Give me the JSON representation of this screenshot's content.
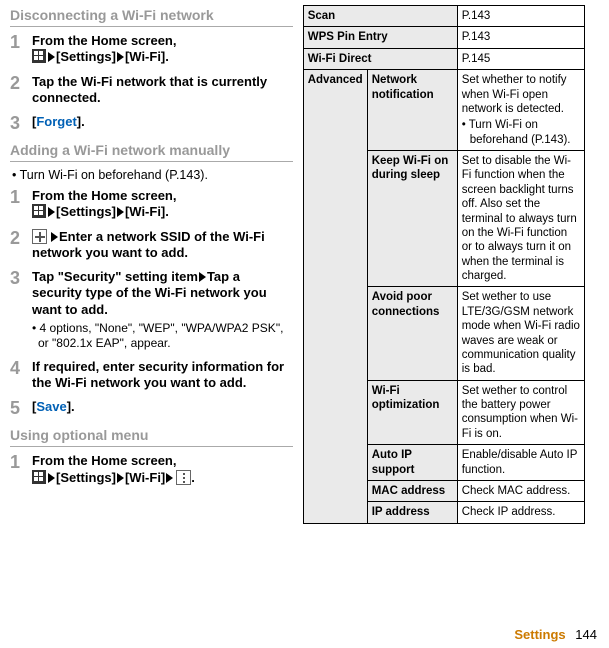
{
  "sections": {
    "disconnect_heading": "Disconnecting a Wi-Fi network",
    "add_heading": "Adding a Wi-Fi network manually",
    "optional_heading": "Using optional menu"
  },
  "disc_steps": {
    "s1a": "From the Home screen,",
    "s1b": "[Settings]",
    "s1c": "[Wi-Fi].",
    "s2": "Tap the Wi-Fi network that is currently connected.",
    "s3_open": "[",
    "s3_link": "Forget",
    "s3_close": "]."
  },
  "add_note": "Turn Wi-Fi on beforehand (P.143).",
  "add_steps": {
    "s1a": "From the Home screen,",
    "s1b": "[Settings]",
    "s1c": "[Wi-Fi].",
    "s2": "Enter a network SSID of the Wi-Fi network you want to add.",
    "s3a": "Tap \"Security\" setting item",
    "s3b": "Tap a security type of the Wi-Fi network you want to add.",
    "s3_sub": "4 options, \"None\", \"WEP\", \"WPA/WPA2 PSK\", or \"802.1x EAP\", appear.",
    "s4": "If required, enter security information for the Wi-Fi network you want to add.",
    "s5_open": "[",
    "s5_link": "Save",
    "s5_close": "]."
  },
  "opt_steps": {
    "s1a": "From the Home screen,",
    "s1b": "[Settings]",
    "s1c": "[Wi-Fi]",
    "s1d": "."
  },
  "table": {
    "scan_k": "Scan",
    "scan_v": "P.143",
    "wps_k": "WPS Pin Entry",
    "wps_v": "P.143",
    "wfd_k": "Wi-Fi Direct",
    "wfd_v": "P.145",
    "adv": "Advanced",
    "nn_k": "Network notification",
    "nn_v": "Set whether to notify when Wi-Fi open network is detected.",
    "nn_sub": "Turn Wi-Fi on beforehand (P.143).",
    "sleep_k": "Keep Wi-Fi on during sleep",
    "sleep_v": "Set to disable the Wi-Fi function when the screen backlight turns off. Also set the terminal to always turn on the Wi-Fi function or to always turn it on when the terminal is charged.",
    "avoid_k": "Avoid poor connections",
    "avoid_v": "Set wether to use LTE/3G/GSM network mode when Wi-Fi radio waves are weak or communication quality is bad.",
    "optz_k": "Wi-Fi optimization",
    "optz_v": "Set wether to control the battery power consumption when Wi-Fi is on.",
    "autoip_k": "Auto IP support",
    "autoip_v": "Enable/disable Auto IP function.",
    "mac_k": "MAC address",
    "mac_v": "Check MAC address.",
    "ip_k": "IP address",
    "ip_v": "Check IP address."
  },
  "footer": {
    "section": "Settings",
    "page": "144"
  }
}
